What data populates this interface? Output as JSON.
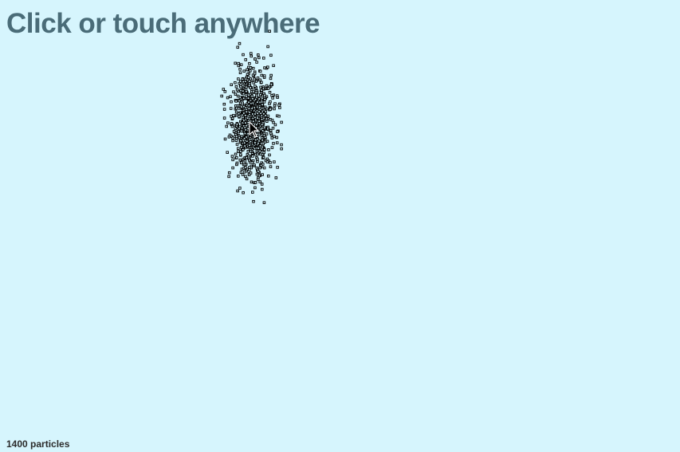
{
  "headline": "Click or touch anywhere",
  "status": {
    "particle_count": 1400,
    "label": "1400 particles"
  },
  "colors": {
    "background": "#d6f5fd",
    "headline": "#4a6c78",
    "particle": "#000000",
    "status_text": "#2b2b2b"
  },
  "pointer": {
    "icon": "arrow-cursor-icon"
  }
}
